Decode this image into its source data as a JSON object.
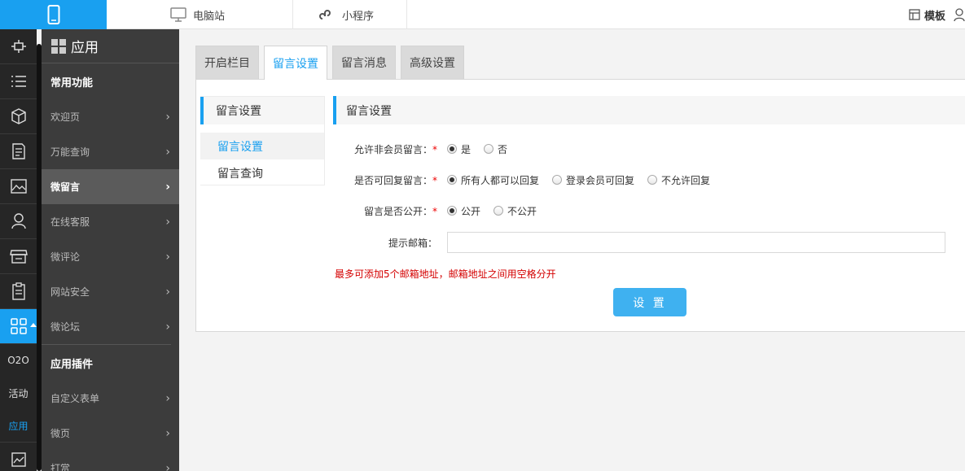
{
  "topbar": {
    "pc_label": "电脑站",
    "mini_label": "小程序",
    "template_label": "模板"
  },
  "rail": {
    "texts": [
      "O2O",
      "活动",
      "应用"
    ]
  },
  "sidebar": {
    "title": "应用",
    "section1": "常用功能",
    "items": [
      "欢迎页",
      "万能查询",
      "微留言",
      "在线客服",
      "微评论",
      "网站安全",
      "微论坛"
    ],
    "section2": "应用插件",
    "items2": [
      "自定义表单",
      "微页",
      "打赏"
    ]
  },
  "tabs": [
    "开启栏目",
    "留言设置",
    "留言消息",
    "高级设置"
  ],
  "subnav": {
    "title": "留言设置",
    "items": [
      "留言设置",
      "留言查询"
    ]
  },
  "form": {
    "title": "留言设置",
    "row1": {
      "label": "允许非会员留言：",
      "options": [
        "是",
        "否"
      ]
    },
    "row2": {
      "label": "是否可回复留言：",
      "options": [
        "所有人都可以回复",
        "登录会员可回复",
        "不允许回复"
      ]
    },
    "row3": {
      "label": "留言是否公开：",
      "options": [
        "公开",
        "不公开"
      ]
    },
    "row4": {
      "label": "提示邮箱：",
      "value": ""
    },
    "hint": "最多可添加5个邮箱地址，邮箱地址之间用空格分开",
    "submit": "设 置"
  },
  "colors": {
    "accent": "#19a0f0",
    "required": "#e00000"
  }
}
